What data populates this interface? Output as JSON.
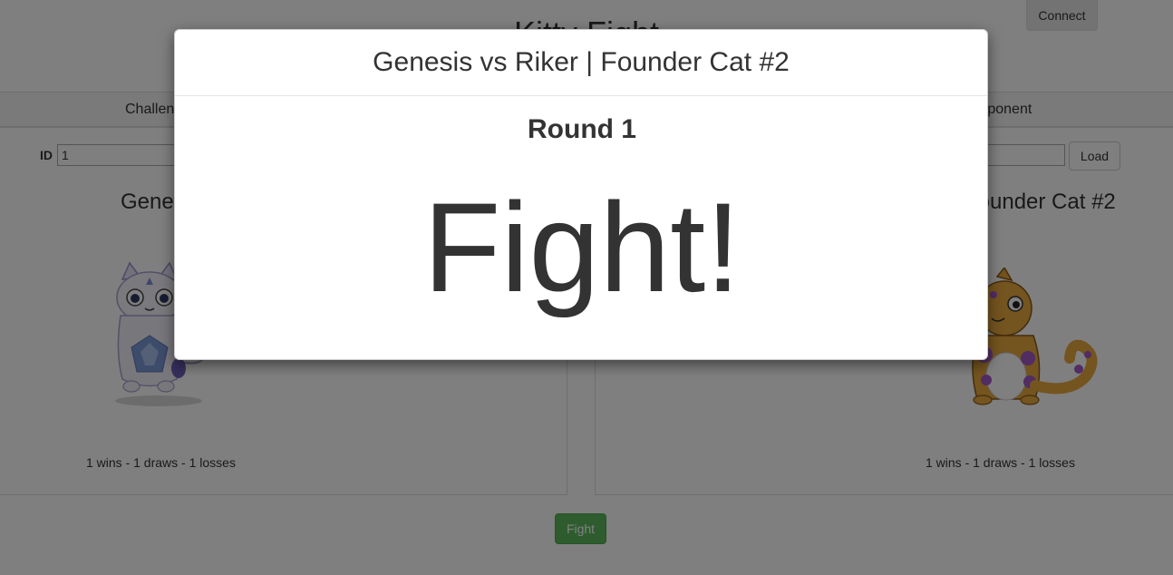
{
  "app": {
    "title": "Kitty Fight",
    "connect_label": "Connect"
  },
  "tabs": {
    "left_label": "Challenger",
    "right_label": "Opponent"
  },
  "left_panel": {
    "id_label": "ID",
    "id_value": "1",
    "kitty_name": "Genesis",
    "record": "1 wins - 1 draws - 1 losses"
  },
  "right_panel": {
    "load_label": "Load",
    "kitty_name": "Founder Cat #2",
    "record": "1 wins - 1 draws - 1 losses"
  },
  "fight_button": {
    "label": "Fight",
    "color": "#5cb85c"
  },
  "modal": {
    "title": "Genesis vs Riker | Founder Cat #2",
    "round": "Round 1",
    "message": "Fight!"
  }
}
